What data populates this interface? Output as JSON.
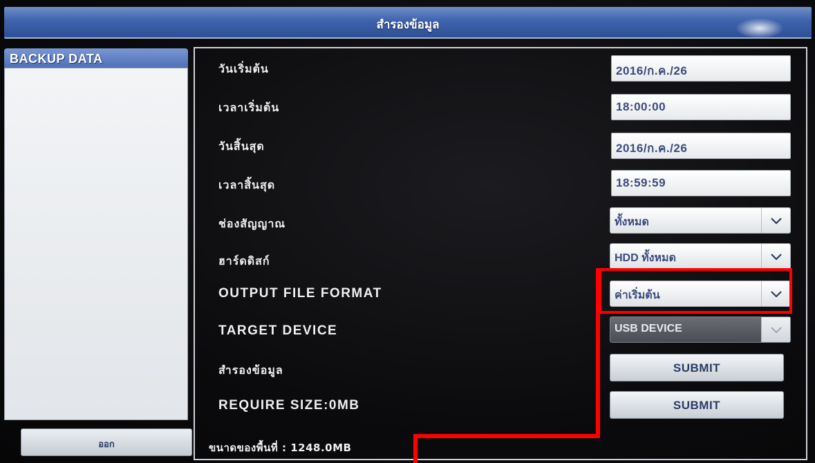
{
  "window": {
    "title": "สำรองข้อมูล"
  },
  "sidebar": {
    "tab_label": "BACKUP DATA",
    "exit_label": "ออก"
  },
  "form": {
    "start_date": {
      "label": "วันเริ่มต้น",
      "value": "2016/ก.ค./26"
    },
    "start_time": {
      "label": "เวลาเริ่มต้น",
      "value": "18:00:00"
    },
    "end_date": {
      "label": "วันสิ้นสุด",
      "value": "2016/ก.ค./26"
    },
    "end_time": {
      "label": "เวลาสิ้นสุด",
      "value": "18:59:59"
    },
    "channel": {
      "label": "ช่องสัญญาณ",
      "value": "ทั้งหมด"
    },
    "harddisk": {
      "label": "ฮาร์ดดิสก์",
      "value": "HDD ทั้งหมด"
    },
    "output_format": {
      "label": "OUTPUT FILE FORMAT",
      "value": "ค่าเริ่มต้น"
    },
    "target_device": {
      "label": "TARGET DEVICE",
      "value": "USB DEVICE"
    },
    "backup": {
      "label": "สำรองข้อมูล",
      "button": "SUBMIT"
    },
    "require_size": {
      "label": "REQUIRE SIZE:0MB",
      "button": "SUBMIT"
    }
  },
  "footer": {
    "free_space": "ขนาดของพื้นที่ : 1248.0MB"
  },
  "colors": {
    "highlight": "#ff0000",
    "title_bar": "#3f63ad",
    "text_value": "#3b4a7c"
  },
  "icons": {
    "dropdown": "chevron-down-icon"
  }
}
